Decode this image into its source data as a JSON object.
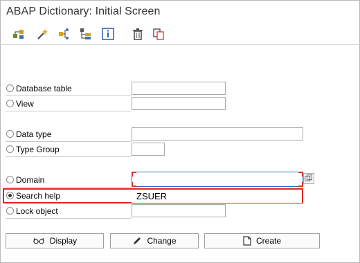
{
  "window": {
    "title": "ABAP Dictionary: Initial Screen"
  },
  "toolbar": {
    "icons": [
      "hierarchy-icon",
      "magic-wand-icon",
      "where-used-icon",
      "tree-icon",
      "info-icon",
      "trash-icon",
      "copy-icon"
    ]
  },
  "objects": [
    {
      "key": "database-table",
      "label": "Database table",
      "value": "",
      "selected": false
    },
    {
      "key": "view",
      "label": "View",
      "value": "",
      "selected": false
    },
    {
      "key": "data-type",
      "label": "Data type",
      "value": "",
      "selected": false
    },
    {
      "key": "type-group",
      "label": "Type Group",
      "value": "",
      "selected": false
    },
    {
      "key": "domain",
      "label": "Domain",
      "value": "",
      "selected": false
    },
    {
      "key": "search-help",
      "label": "Search help",
      "value": "ZSUER",
      "selected": true
    },
    {
      "key": "lock-object",
      "label": "Lock object",
      "value": "",
      "selected": false
    }
  ],
  "buttons": {
    "display": "Display",
    "change": "Change",
    "create": "Create"
  },
  "colors": {
    "highlight": "#e1241c",
    "focus": "#2b6cc7"
  }
}
